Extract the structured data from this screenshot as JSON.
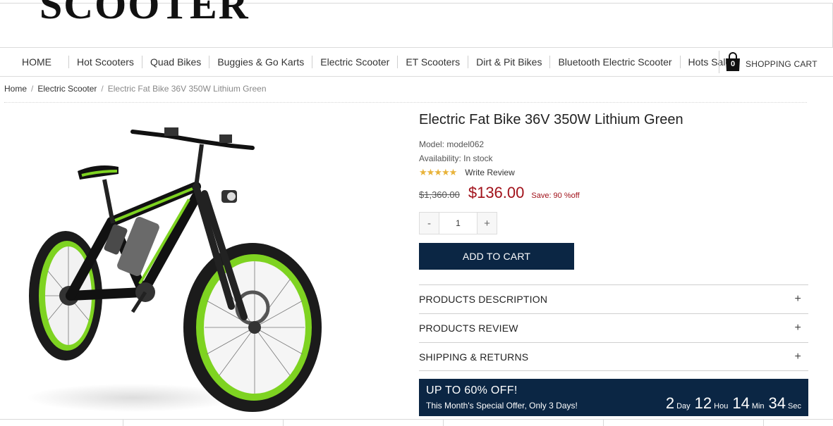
{
  "header": {
    "logo_text": "SCOOTER"
  },
  "nav": {
    "items": [
      "HOME",
      "Hot Scooters",
      "Quad Bikes",
      "Buggies & Go Karts",
      "Electric Scooter",
      "ET Scooters",
      "Dirt & Pit Bikes",
      "Bluetooth Electric Scooter",
      "Hots Sale"
    ],
    "cart_count": "0",
    "cart_label": "SHOPPING CART",
    "cart_icon": "shopping-bag-icon"
  },
  "breadcrumb": {
    "home": "Home",
    "category": "Electric Scooter",
    "current": "Electric Fat Bike 36V 350W Lithium Green",
    "separator": "/"
  },
  "product": {
    "title": "Electric Fat Bike 36V 350W Lithium Green",
    "model": "Model: model062",
    "availability": "Availability: In stock",
    "stars": "★★★★★",
    "write_review": "Write Review",
    "old_price": "$1,360.00",
    "new_price": "$136.00",
    "save": "Save: 90 %off",
    "qty_minus": "-",
    "qty_value": "1",
    "qty_plus": "+",
    "add_to_cart": "ADD TO CART",
    "image_subject": "green electric fat bike",
    "accent_color": "#0b2644",
    "price_color": "#a1111a"
  },
  "accordion": [
    {
      "label": "PRODUCTS DESCRIPTION",
      "icon": "+"
    },
    {
      "label": "PRODUCTS REVIEW",
      "icon": "+"
    },
    {
      "label": "SHIPPING & RETURNS",
      "icon": "+"
    }
  ],
  "promo": {
    "headline": "UP TO 60% OFF!",
    "subline": "This Month's Special Offer, Only 3 Days!",
    "days": "2",
    "days_unit": "Day",
    "hours": "12",
    "hours_unit": "Hou",
    "minutes": "14",
    "minutes_unit": "Min",
    "seconds": "34",
    "seconds_unit": "Sec"
  }
}
